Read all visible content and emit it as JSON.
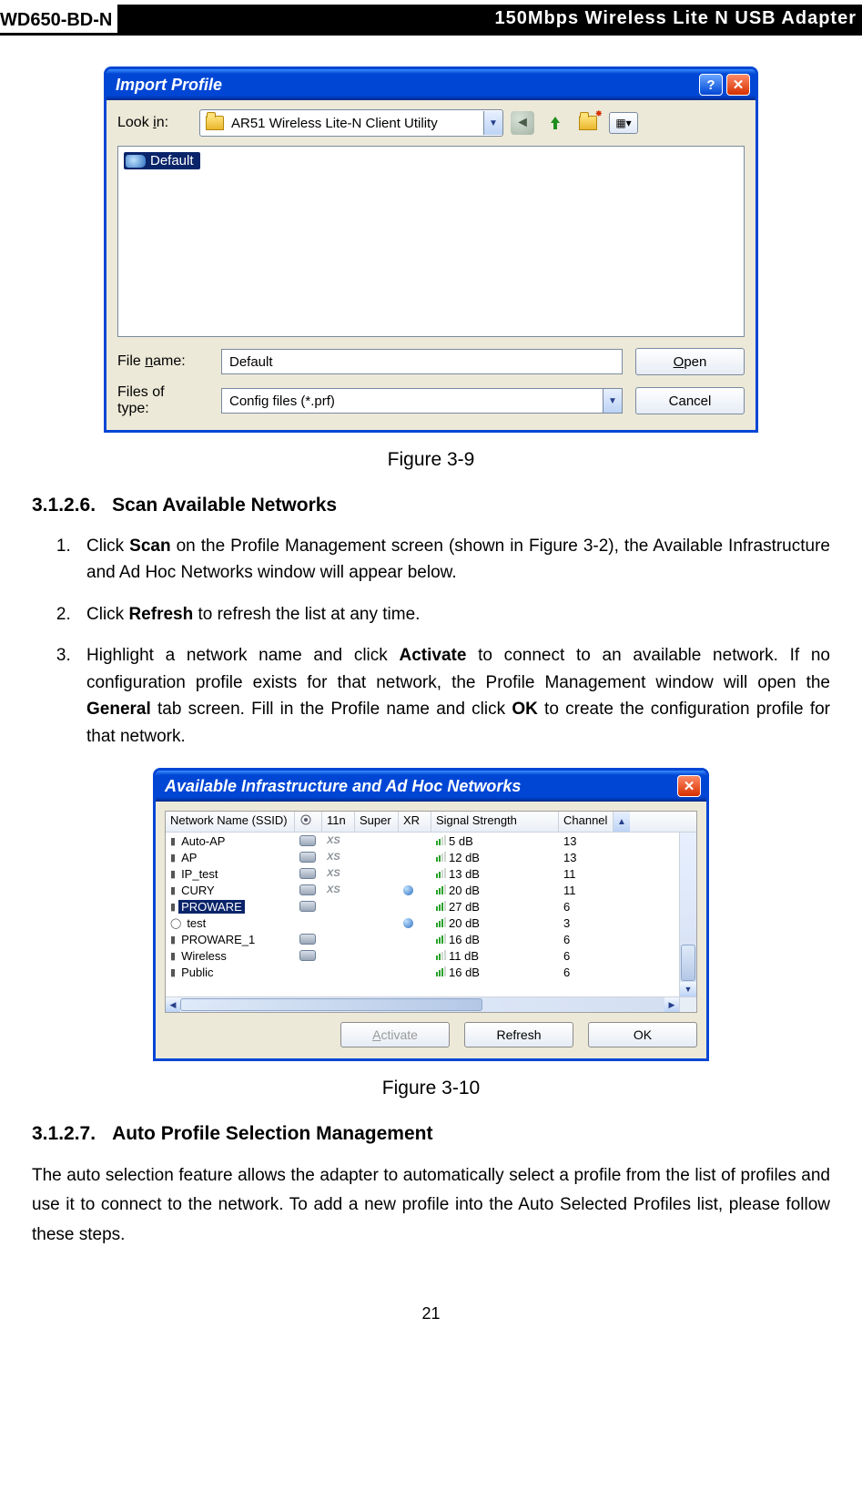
{
  "header": {
    "model": "WD650-BD-N",
    "title": "150Mbps  Wireless  Lite  N  USB  Adapter"
  },
  "dialog1": {
    "title": "Import Profile",
    "lookin_label_pre": "Look ",
    "lookin_label_u": "i",
    "lookin_label_post": "n:",
    "folder": "AR51 Wireless Lite-N Client Utility",
    "selected_file": "Default",
    "filename_label_pre": "File ",
    "filename_label_u": "n",
    "filename_label_post": "ame:",
    "filetype_label": "Files of type:",
    "filetype_value": "Config files (*.prf)",
    "filename_value": "Default",
    "open_btn_u": "O",
    "open_btn_rest": "pen",
    "cancel_btn": "Cancel"
  },
  "caption1": "Figure 3-9",
  "section1": {
    "num": "3.1.2.6.",
    "title": "Scan Available Networks"
  },
  "steps": {
    "s1a": "Click ",
    "s1b": "Scan",
    "s1c": "  on  the  Profile  Management  screen  (shown  in  Figure  3-2),  the  Available Infrastructure and Ad Hoc Networks window will appear below.",
    "s2a": "Click ",
    "s2b": "Refresh",
    "s2c": " to refresh the list at any time.",
    "s3a": "Highlight  a  network  name  and  click  ",
    "s3b": "Activate",
    "s3c": "  to  connect  to  an  available  network.  If  no configuration profile exists for that network, the Profile Management window will open the ",
    "s3d": "General",
    "s3e": " tab screen. Fill in the Profile name and click ",
    "s3f": "OK",
    "s3g": " to create the configuration profile for that network."
  },
  "dialog2": {
    "title": "Available Infrastructure and Ad Hoc Networks",
    "columns": {
      "ssid": "Network Name (SSID)",
      "sec": "",
      "n": "11n",
      "super": "Super",
      "xr": "XR",
      "signal": "Signal Strength",
      "chan": "Channel"
    },
    "rows": [
      {
        "name": "Auto-AP",
        "ap": "i",
        "sec": true,
        "xs": true,
        "xr": false,
        "db": "5 dB",
        "chan": "13",
        "sel": false,
        "bars": 2
      },
      {
        "name": "AP",
        "ap": "i",
        "sec": true,
        "xs": true,
        "xr": false,
        "db": "12 dB",
        "chan": "13",
        "sel": false,
        "bars": 2
      },
      {
        "name": "IP_test",
        "ap": "i",
        "sec": true,
        "xs": true,
        "xr": false,
        "db": "13 dB",
        "chan": "11",
        "sel": false,
        "bars": 2
      },
      {
        "name": "CURY",
        "ap": "i",
        "sec": true,
        "xs": true,
        "xr": true,
        "db": "20 dB",
        "chan": "11",
        "sel": false,
        "bars": 3
      },
      {
        "name": "PROWARE",
        "ap": "i",
        "sec": true,
        "xs": false,
        "xr": false,
        "db": "27 dB",
        "chan": "6",
        "sel": true,
        "bars": 3
      },
      {
        "name": "test",
        "ap": "o",
        "sec": false,
        "xs": false,
        "xr": true,
        "db": "20 dB",
        "chan": "3",
        "sel": false,
        "bars": 3
      },
      {
        "name": "PROWARE_1",
        "ap": "i",
        "sec": true,
        "xs": false,
        "xr": false,
        "db": "16 dB",
        "chan": "6",
        "sel": false,
        "bars": 3
      },
      {
        "name": "Wireless",
        "ap": "i",
        "sec": true,
        "xs": false,
        "xr": false,
        "db": "11 dB",
        "chan": "6",
        "sel": false,
        "bars": 2
      },
      {
        "name": "Public",
        "ap": "i",
        "sec": false,
        "xs": false,
        "xr": false,
        "db": "16 dB",
        "chan": "6",
        "sel": false,
        "bars": 3
      }
    ],
    "buttons": {
      "activate_u": "A",
      "activate_rest": "ctivate",
      "refresh": "Refresh",
      "ok": "OK"
    }
  },
  "caption2": "Figure 3-10",
  "section2": {
    "num": "3.1.2.7.",
    "title": "Auto Profile Selection Management"
  },
  "para2": "The auto selection feature allows the adapter to automatically select a profile from the list of profiles  and  use  it  to  connect  to  the  network.  To  add  a  new  profile  into  the  Auto  Selected Profiles list, please follow these steps.",
  "page_number": "21"
}
